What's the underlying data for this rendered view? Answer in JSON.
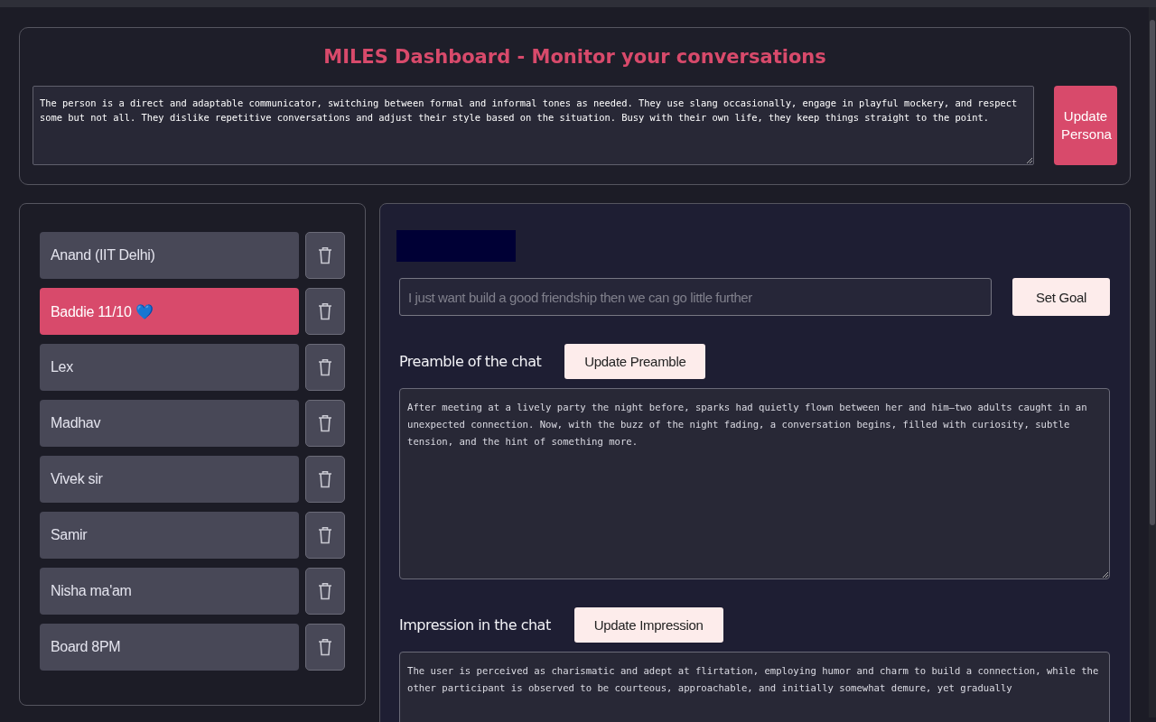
{
  "header": {
    "title": "MILES Dashboard - Monitor your conversations",
    "persona": {
      "value": "The person is a direct and adaptable communicator, switching between formal and informal tones as needed. They use slang occasionally, engage in playful mockery, and respect some but not all. They dislike repetitive conversations and adjust their style based on the situation. Busy with their own life, they keep things straight to the point."
    },
    "button": "Update Persona"
  },
  "contacts": [
    {
      "name": "Anand (IIT Delhi)",
      "selected": false
    },
    {
      "name": "Baddie 11/10 💙",
      "selected": true
    },
    {
      "name": "Lex",
      "selected": false
    },
    {
      "name": "Madhav",
      "selected": false
    },
    {
      "name": "Vivek sir",
      "selected": false
    },
    {
      "name": "Samir",
      "selected": false
    },
    {
      "name": "Nisha ma'am",
      "selected": false
    },
    {
      "name": "Board 8PM",
      "selected": false
    }
  ],
  "goal": {
    "placeholder": "I just want build a good friendship then we can go little further",
    "button": "Set Goal"
  },
  "sections": [
    {
      "label": "Preamble of the chat",
      "button": "Update Preamble",
      "value": "After meeting at a lively party the night before, sparks had quietly flown between her and him—two adults caught in an unexpected connection. Now, with the buzz of the night fading, a conversation begins, filled with curiosity, subtle tension, and the hint of something more."
    },
    {
      "label": "Impression in the chat",
      "button": "Update Impression",
      "value": "The user is perceived as charismatic and adept at flirtation, employing humor and charm to build a connection, while the other participant is observed to be courteous, approachable, and initially somewhat demure, yet gradually"
    }
  ]
}
